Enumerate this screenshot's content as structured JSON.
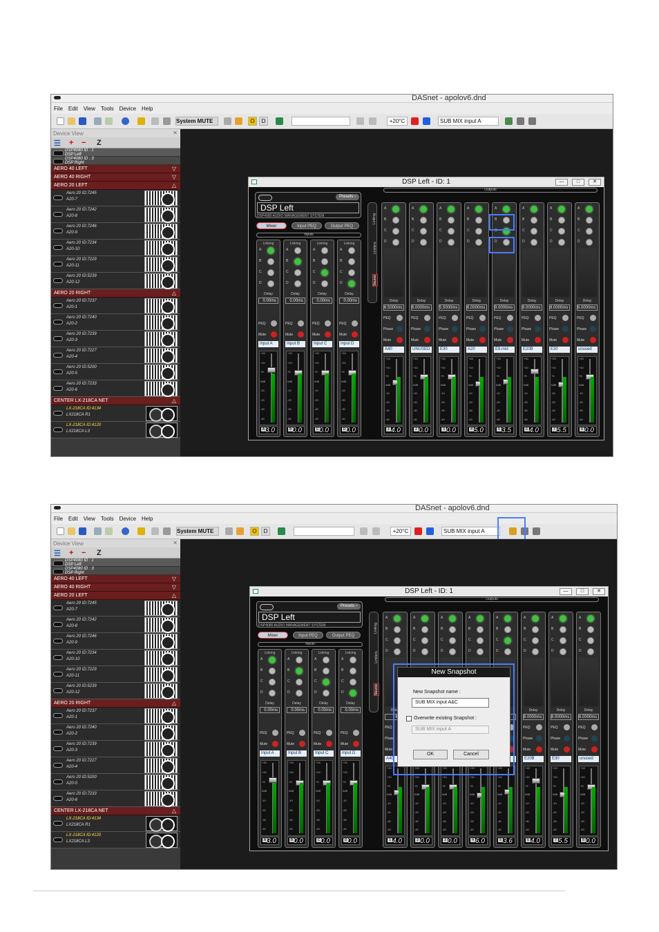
{
  "app": {
    "title": "DASnet - apolov6.dnd",
    "menu": [
      "File",
      "Edit",
      "View",
      "Tools",
      "Device",
      "Help"
    ],
    "system_mute": "System MUTE",
    "temperature": "+20°C",
    "snapshot_select": "SUB MIX input A"
  },
  "device_view": {
    "title": "Device View",
    "dsp_items": [
      {
        "line1": "DSP4080  ID : 1",
        "line2": "DSP Left"
      },
      {
        "line1": "DSP4080  ID : 3",
        "line2": "DSP Right"
      }
    ],
    "groups_top": [
      "AERO 40 LEFT",
      "AERO 40 RIGHT",
      "AERO 20 LEFT"
    ],
    "aero20_left": [
      {
        "id": "Aero 20  ID:7245",
        "name": "A20-7"
      },
      {
        "id": "Aero 20  ID:7242",
        "name": "A20-8"
      },
      {
        "id": "Aero 20  ID:7246",
        "name": "A20-9"
      },
      {
        "id": "Aero 20  ID:7234",
        "name": "A20-10"
      },
      {
        "id": "Aero 20  ID:7229",
        "name": "A20-11"
      },
      {
        "id": "Aero 20  ID:5239",
        "name": "A20-12"
      }
    ],
    "group_right": "AERO 20 RIGHT",
    "aero20_right": [
      {
        "id": "Aero 20  ID:7237",
        "name": "A20-1"
      },
      {
        "id": "Aero 20  ID:7240",
        "name": "A20-2"
      },
      {
        "id": "Aero 20  ID:7239",
        "name": "A20-3"
      },
      {
        "id": "Aero 20  ID:7227",
        "name": "A20-4"
      },
      {
        "id": "Aero 20  ID:5200",
        "name": "A20-5"
      },
      {
        "id": "Aero 20  ID:7233",
        "name": "A20-6"
      }
    ],
    "group_center": "CENTER LX-218CA NET",
    "lx_items": [
      {
        "id": "LX-218CA  ID:4134",
        "name": "LX218CA R1"
      },
      {
        "id": "LX-218CA  ID:4120",
        "name": "LX218CA L3"
      }
    ]
  },
  "dsp_window": {
    "title": "DSP Left - ID: 1",
    "presets": "Presets",
    "name": "DSP Left",
    "subtitle": "DSP4080  AUDIO MANAGEMENT SYSTEM",
    "tabs": [
      "Mixer",
      "Input PEQ",
      "Output PEQ"
    ],
    "inputs_label": "Inputs",
    "outputs_label": "Outputs",
    "side_tabs": [
      "Linking",
      "Limiters",
      "Source"
    ],
    "linking": "Linking",
    "delay_label": "Delay",
    "peq": "PEQ",
    "mute": "Mute",
    "phase": "Phase",
    "inputs": [
      {
        "name": "Input A",
        "delay": "0.00ms",
        "gain": "3.0",
        "num": "A",
        "active": 0
      },
      {
        "name": "Input B",
        "delay": "0.00ms",
        "gain": "0.0",
        "num": "B",
        "active": 1
      },
      {
        "name": "Input C",
        "delay": "0.00ms",
        "gain": "0.0",
        "num": "C",
        "active": 2
      },
      {
        "name": "Input D",
        "delay": "0.00ms",
        "gain": "0.0",
        "num": "D",
        "active": 3
      }
    ],
    "outputs_top": [
      {
        "name": "A40",
        "delay": "6.5000ms",
        "gain": "-4.0",
        "num": "1"
      },
      {
        "name": "UNUSED",
        "delay": "6.0000ms",
        "gain": "0.0",
        "num": "2"
      },
      {
        "name": "E30",
        "delay": "5.5000ms",
        "gain": "0.0",
        "num": "3"
      },
      {
        "name": "A20",
        "delay": "6.0000ms",
        "gain": "-5.0",
        "num": "4"
      },
      {
        "name": "E8.mid",
        "delay": "9.0000ms",
        "gain": "-3.5",
        "num": "5"
      },
      {
        "name": "E20B",
        "delay": "8.0000ms",
        "gain": "4.0",
        "num": "6"
      },
      {
        "name": "E30",
        "delay": "8.0000ms",
        "gain": "-5.5",
        "num": "7"
      },
      {
        "name": "unused",
        "delay": "6.0000ms",
        "gain": "0.0",
        "num": "8"
      }
    ],
    "outputs_bottom": [
      {
        "name": "A40",
        "delay": "6.50",
        "gain": "-4.0",
        "num": "1"
      },
      {
        "name": "",
        "delay": "",
        "gain": "0.0",
        "num": "2"
      },
      {
        "name": "",
        "delay": "",
        "gain": "0.0",
        "num": "3"
      },
      {
        "name": "",
        "delay": "",
        "gain": "-6.0",
        "num": "4"
      },
      {
        "name": "",
        "delay": "",
        "gain": "-3.6",
        "num": "5"
      },
      {
        "name": "E20B",
        "delay": "8.0000ms",
        "gain": "4.0",
        "num": "6"
      },
      {
        "name": "E30",
        "delay": "8.0000ms",
        "gain": "-5.5",
        "num": "7"
      },
      {
        "name": "unused",
        "delay": "6.0000ms",
        "gain": "0.0",
        "num": "8"
      }
    ],
    "scale": [
      "+15",
      "+10",
      "+5",
      "0dB",
      "-10",
      "-20",
      "-30",
      "-40"
    ]
  },
  "dialog": {
    "title": "New Snapshot",
    "name_label": "New Snapshot name :",
    "name_value": "SUB MIX input A&C",
    "overwrite_label": "Overwrite existing Snapshot :",
    "overwrite_value": "SUB MIX input A",
    "ok": "OK",
    "cancel": "Cancel"
  },
  "colors": {
    "group": "#6a1e1e",
    "highlight": "#4a7cff",
    "led_on": "#33cc33"
  }
}
